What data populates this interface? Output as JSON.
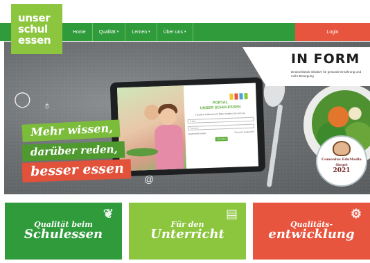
{
  "logo": {
    "line1": "unser",
    "line2": "schul",
    "line3": "essen"
  },
  "nav": {
    "items": [
      {
        "label": "Home",
        "dropdown": false
      },
      {
        "label": "Qualität",
        "dropdown": true
      },
      {
        "label": "Lernen",
        "dropdown": true
      },
      {
        "label": "Über uns",
        "dropdown": true
      }
    ],
    "login_label": "Login",
    "caret": "▾"
  },
  "hero": {
    "inform": {
      "title": "IN FORM",
      "subtitle": "Deutschlands Initiative für gesunde Ernährung und mehr Bewegung"
    },
    "tablet": {
      "portal_title_1": "PORTAL",
      "portal_title_2": "UNSER SCHULESSEN",
      "welcome": "Herzlich willkommen! Bitte melden Sie sich an.",
      "field_user": "E-Mail",
      "field_pass": "Passwort",
      "remember": "Angemeldet bleiben",
      "forgot": "Passwort vergessen?",
      "button": "Anmelden"
    },
    "slogan": {
      "line1": "Mehr wissen,",
      "line2": "darüber reden,",
      "line3": "besser essen"
    },
    "seal": {
      "line1": "Comenius EduMedia",
      "line2": "Siegel",
      "year": "2021"
    }
  },
  "cards": [
    {
      "line1": "Qualität beim",
      "line2": "Schulessen"
    },
    {
      "line1": "Für den",
      "line2": "Unterricht"
    },
    {
      "line1": "Qualitäts-",
      "line2": "entwicklung"
    }
  ],
  "colors": {
    "green_dark": "#2f9b3b",
    "green_light": "#8cc63f",
    "red": "#e8553f"
  },
  "icons": {
    "card1": "radish-icon",
    "card2": "book-icon",
    "card3": "gears-icon"
  }
}
